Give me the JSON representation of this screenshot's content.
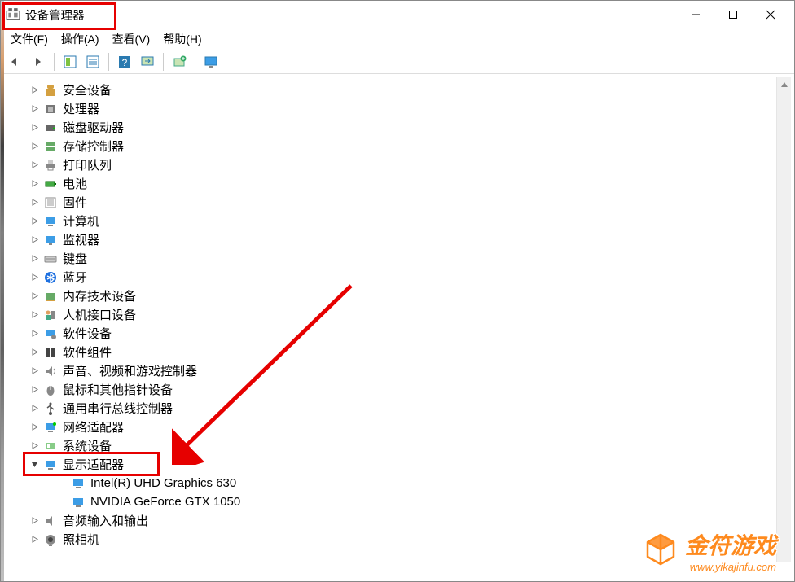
{
  "window": {
    "title": "设备管理器"
  },
  "menubar": {
    "file": "文件(F)",
    "action": "操作(A)",
    "view": "查看(V)",
    "help": "帮助(H)"
  },
  "tree": {
    "items": [
      {
        "label": "安全设备",
        "icon": "security",
        "expanded": false
      },
      {
        "label": "处理器",
        "icon": "cpu",
        "expanded": false
      },
      {
        "label": "磁盘驱动器",
        "icon": "disk",
        "expanded": false
      },
      {
        "label": "存储控制器",
        "icon": "storage",
        "expanded": false
      },
      {
        "label": "打印队列",
        "icon": "printer",
        "expanded": false
      },
      {
        "label": "电池",
        "icon": "battery",
        "expanded": false
      },
      {
        "label": "固件",
        "icon": "firmware",
        "expanded": false
      },
      {
        "label": "计算机",
        "icon": "computer",
        "expanded": false
      },
      {
        "label": "监视器",
        "icon": "monitor",
        "expanded": false
      },
      {
        "label": "键盘",
        "icon": "keyboard",
        "expanded": false
      },
      {
        "label": "蓝牙",
        "icon": "bluetooth",
        "expanded": false
      },
      {
        "label": "内存技术设备",
        "icon": "memory",
        "expanded": false
      },
      {
        "label": "人机接口设备",
        "icon": "hid",
        "expanded": false
      },
      {
        "label": "软件设备",
        "icon": "software",
        "expanded": false
      },
      {
        "label": "软件组件",
        "icon": "component",
        "expanded": false
      },
      {
        "label": "声音、视频和游戏控制器",
        "icon": "sound",
        "expanded": false
      },
      {
        "label": "鼠标和其他指针设备",
        "icon": "mouse",
        "expanded": false
      },
      {
        "label": "通用串行总线控制器",
        "icon": "usb",
        "expanded": false
      },
      {
        "label": "网络适配器",
        "icon": "network",
        "expanded": false
      },
      {
        "label": "系统设备",
        "icon": "system",
        "expanded": false
      },
      {
        "label": "显示适配器",
        "icon": "display",
        "expanded": true,
        "children": [
          {
            "label": "Intel(R) UHD Graphics 630",
            "icon": "display"
          },
          {
            "label": "NVIDIA GeForce GTX 1050",
            "icon": "display"
          }
        ]
      },
      {
        "label": "音频输入和输出",
        "icon": "audio",
        "expanded": false
      },
      {
        "label": "照相机",
        "icon": "camera",
        "expanded": false
      }
    ]
  },
  "watermark": {
    "brand": "金符游戏",
    "url": "www.yikajinfu.com"
  },
  "colors": {
    "accent_red": "#e60000",
    "watermark_orange": "#fe8a1e"
  }
}
